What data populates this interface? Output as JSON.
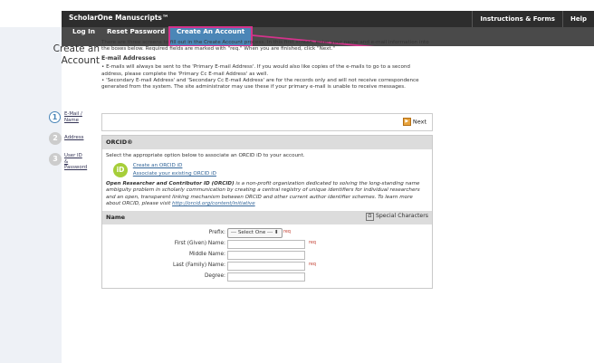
{
  "header": {
    "brand": "ScholarOne Manuscripts™",
    "links": [
      "Instructions & Forms",
      "Help"
    ]
  },
  "nav": {
    "items": [
      "Log In",
      "Reset Password",
      "Create An Account"
    ],
    "active_index": 2
  },
  "page": {
    "title_line1": "Create an",
    "title_line2": "Account",
    "intro": "There are three screens to fill out in the Create Account process. In this first screen, enter your name and e-mail information into the boxes below. Required fields are marked with \"req.\" When you are finished, click \"Next.\"",
    "email_heading": "E-mail Addresses",
    "bullets": [
      "E-mails will always be sent to the 'Primary E-mail Address'. If you would also like copies of the e-mails to go to a second address, please complete the 'Primary Cc E-mail Address' as well.",
      "'Secondary E-mail Address' and 'Secondary Cc E-mail Address' are for the records only and will not receive correspondence generated from the system. The site administrator may use these if your primary e-mail is unable to receive messages."
    ]
  },
  "steps": [
    {
      "number": "1",
      "label_line1": "E-Mail /",
      "label_line2": "Name",
      "label_line3": ""
    },
    {
      "number": "2",
      "label_line1": "Address",
      "label_line2": "",
      "label_line3": ""
    },
    {
      "number": "3",
      "label_line1": "User ID",
      "label_line2": "&",
      "label_line3": "Password"
    }
  ],
  "next_label": "Next",
  "orcid": {
    "heading": "ORCID®",
    "instruction": "Select the appropriate option below to associate an ORCID iD to your account.",
    "logo": "iD",
    "create_link": "Create an ORCID iD",
    "associate_link": "Associate your existing ORCID iD",
    "desc_bold": "Open Researcher and Contributor ID (ORCID)",
    "desc_rest": " is a non-profit organization dedicated to solving the long-standing name ambiguity problem in scholarly communication by creating a central registry of unique identifiers for individual researchers and an open, transparent linking mechanism between ORCID and other current author identifier schemes. To learn more about ORCID, please visit ",
    "desc_link": "http://orcid.org/content/initiative"
  },
  "name_section": {
    "heading": "Name",
    "special_chars": "Special Characters",
    "special_icon": "Ω",
    "fields": [
      {
        "label": "Prefix:",
        "type": "select",
        "value": "--- Select One ---",
        "req": "req"
      },
      {
        "label": "First (Given) Name:",
        "type": "text",
        "value": "",
        "req": "req"
      },
      {
        "label": "Middle Name:",
        "type": "text",
        "value": "",
        "req": ""
      },
      {
        "label": "Last (Family) Name:",
        "type": "text",
        "value": "",
        "req": "req"
      },
      {
        "label": "Degree:",
        "type": "text",
        "value": "",
        "req": ""
      }
    ]
  },
  "colors": {
    "accent": "#4b86b7",
    "highlight": "#d3338b",
    "orcid_green": "#a6ce39"
  }
}
